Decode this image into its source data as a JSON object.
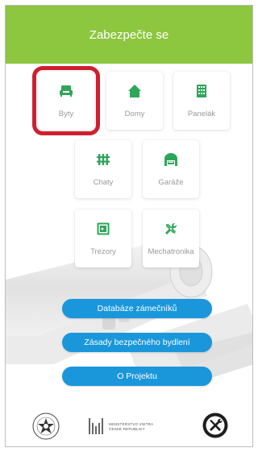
{
  "header": {
    "title": "Zabezpečte se"
  },
  "colors": {
    "header_bg": "#8dc63f",
    "accent_green": "#2fa55a",
    "button_blue": "#1a97db",
    "selection_red": "#cf1f2f"
  },
  "tiles": [
    {
      "id": "byty",
      "label": "Byty",
      "icon": "sofa-icon",
      "selected": true
    },
    {
      "id": "domy",
      "label": "Domy",
      "icon": "house-icon",
      "selected": false
    },
    {
      "id": "panelak",
      "label": "Panelák",
      "icon": "building-icon",
      "selected": false
    },
    {
      "id": "chaty",
      "label": "Chaty",
      "icon": "fence-icon",
      "selected": false
    },
    {
      "id": "garaze",
      "label": "Garáže",
      "icon": "garage-car-icon",
      "selected": false
    },
    {
      "id": "trezory",
      "label": "Trezory",
      "icon": "safe-icon",
      "selected": false
    },
    {
      "id": "mechatronika",
      "label": "Mechatronika",
      "icon": "wrench-screwdriver-icon",
      "selected": false
    }
  ],
  "buttons": {
    "database": "Databáze zámečníků",
    "principles": "Zásady bezpečného bydlení",
    "about": "O Projektu"
  },
  "footer": {
    "ministry_line1": "MINISTERSTVO VNITRA",
    "ministry_line2": "ČESKÉ REPUBLIKY",
    "police_text": "POLICIE ČESKÉ REPUBLIKY"
  }
}
